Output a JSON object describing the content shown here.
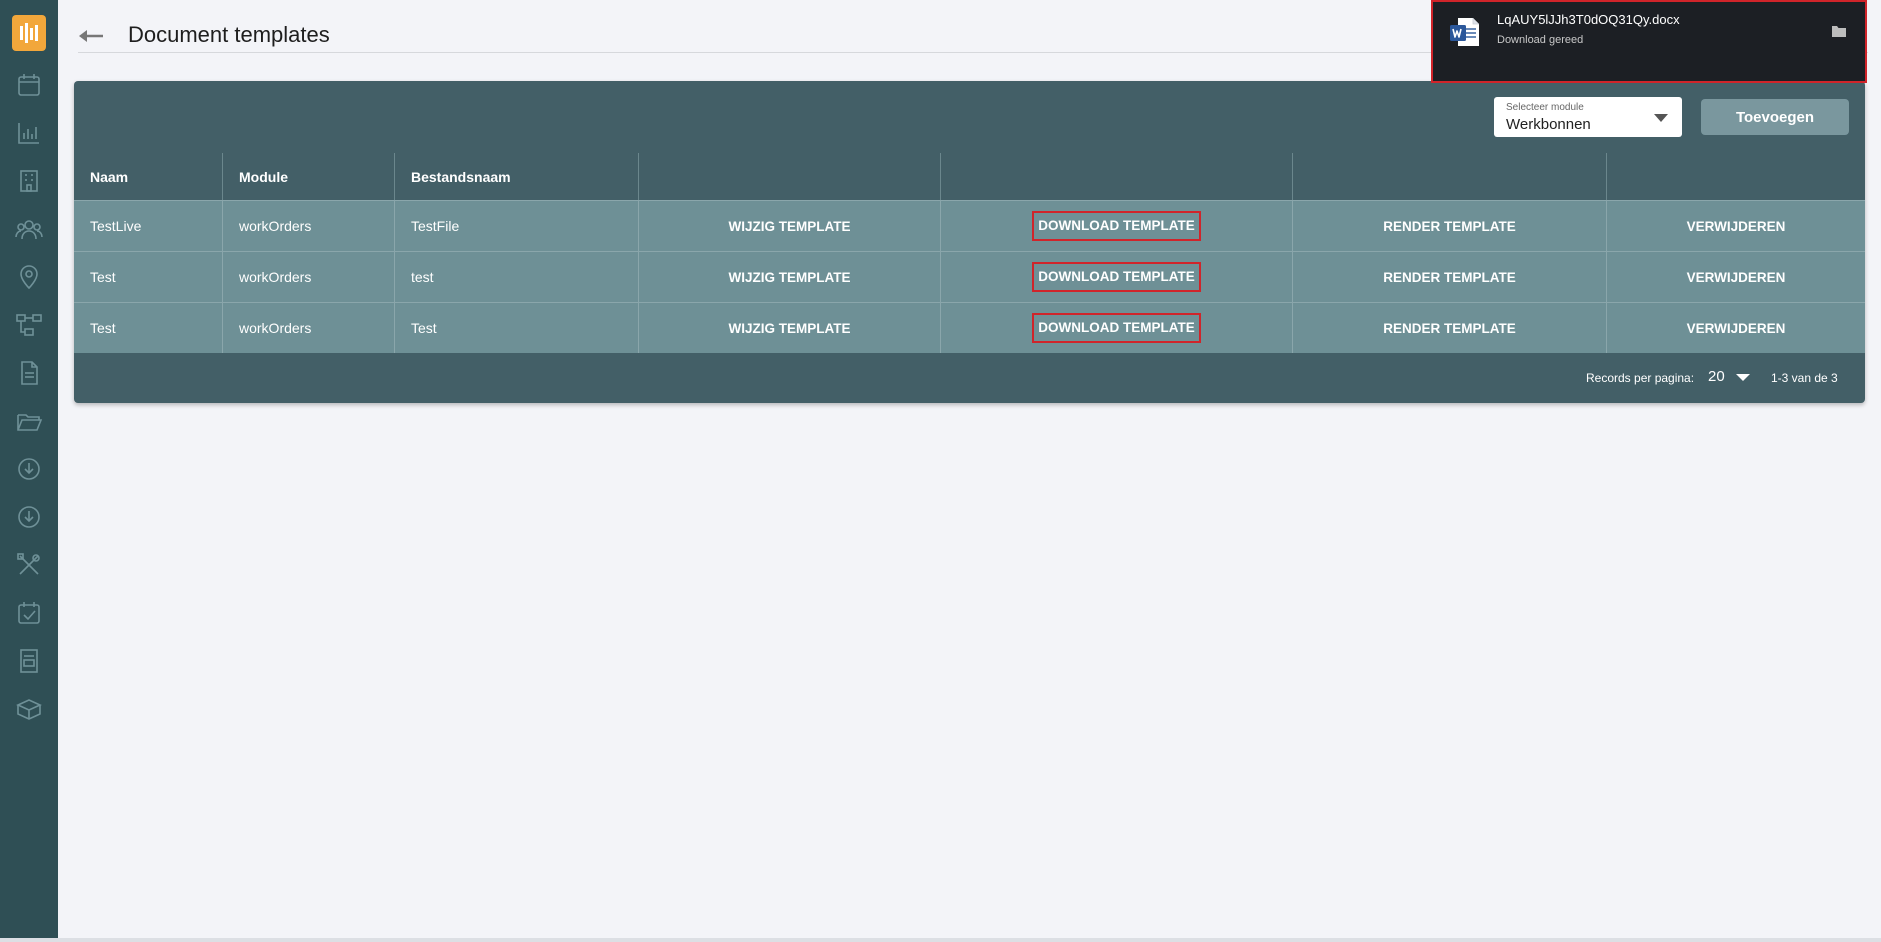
{
  "page": {
    "title": "Document templates"
  },
  "toolbar": {
    "module_select_label": "Selecteer module",
    "module_select_value": "Werkbonnen",
    "add_button": "Toevoegen"
  },
  "table": {
    "headers": [
      "Naam",
      "Module",
      "Bestandsnaam",
      "",
      "",
      "",
      ""
    ],
    "rows": [
      {
        "naam": "TestLive",
        "module": "workOrders",
        "bestandsnaam": "TestFile",
        "edit": "WIJZIG TEMPLATE",
        "download": "DOWNLOAD TEMPLATE",
        "render": "RENDER TEMPLATE",
        "delete": "VERWIJDEREN"
      },
      {
        "naam": "Test",
        "module": "workOrders",
        "bestandsnaam": "test",
        "edit": "WIJZIG TEMPLATE",
        "download": "DOWNLOAD TEMPLATE",
        "render": "RENDER TEMPLATE",
        "delete": "VERWIJDEREN"
      },
      {
        "naam": "Test",
        "module": "workOrders",
        "bestandsnaam": "Test",
        "edit": "WIJZIG TEMPLATE",
        "download": "DOWNLOAD TEMPLATE",
        "render": "RENDER TEMPLATE",
        "delete": "VERWIJDEREN"
      }
    ]
  },
  "pagination": {
    "records_per_page_label": "Records per pagina:",
    "records_per_page_value": "20",
    "range": "1-3 van de 3"
  },
  "download": {
    "filename": "LqAUY5lJJh3T0dOQ31Qy.docx",
    "status": "Download gereed"
  },
  "sidebar": {
    "icons": [
      "calendar-icon",
      "chart-icon",
      "building-icon",
      "users-icon",
      "location-icon",
      "workflow-icon",
      "document-icon",
      "folder-icon",
      "download-circle-icon",
      "download-circle-icon",
      "tools-icon",
      "calendar-check-icon",
      "form-icon",
      "box-icon"
    ]
  },
  "colors": {
    "sidebar": "#2f4f55",
    "accent": "#f2a73b",
    "card": "#435f67",
    "row": "#6e9096",
    "highlight": "#d0242a"
  }
}
